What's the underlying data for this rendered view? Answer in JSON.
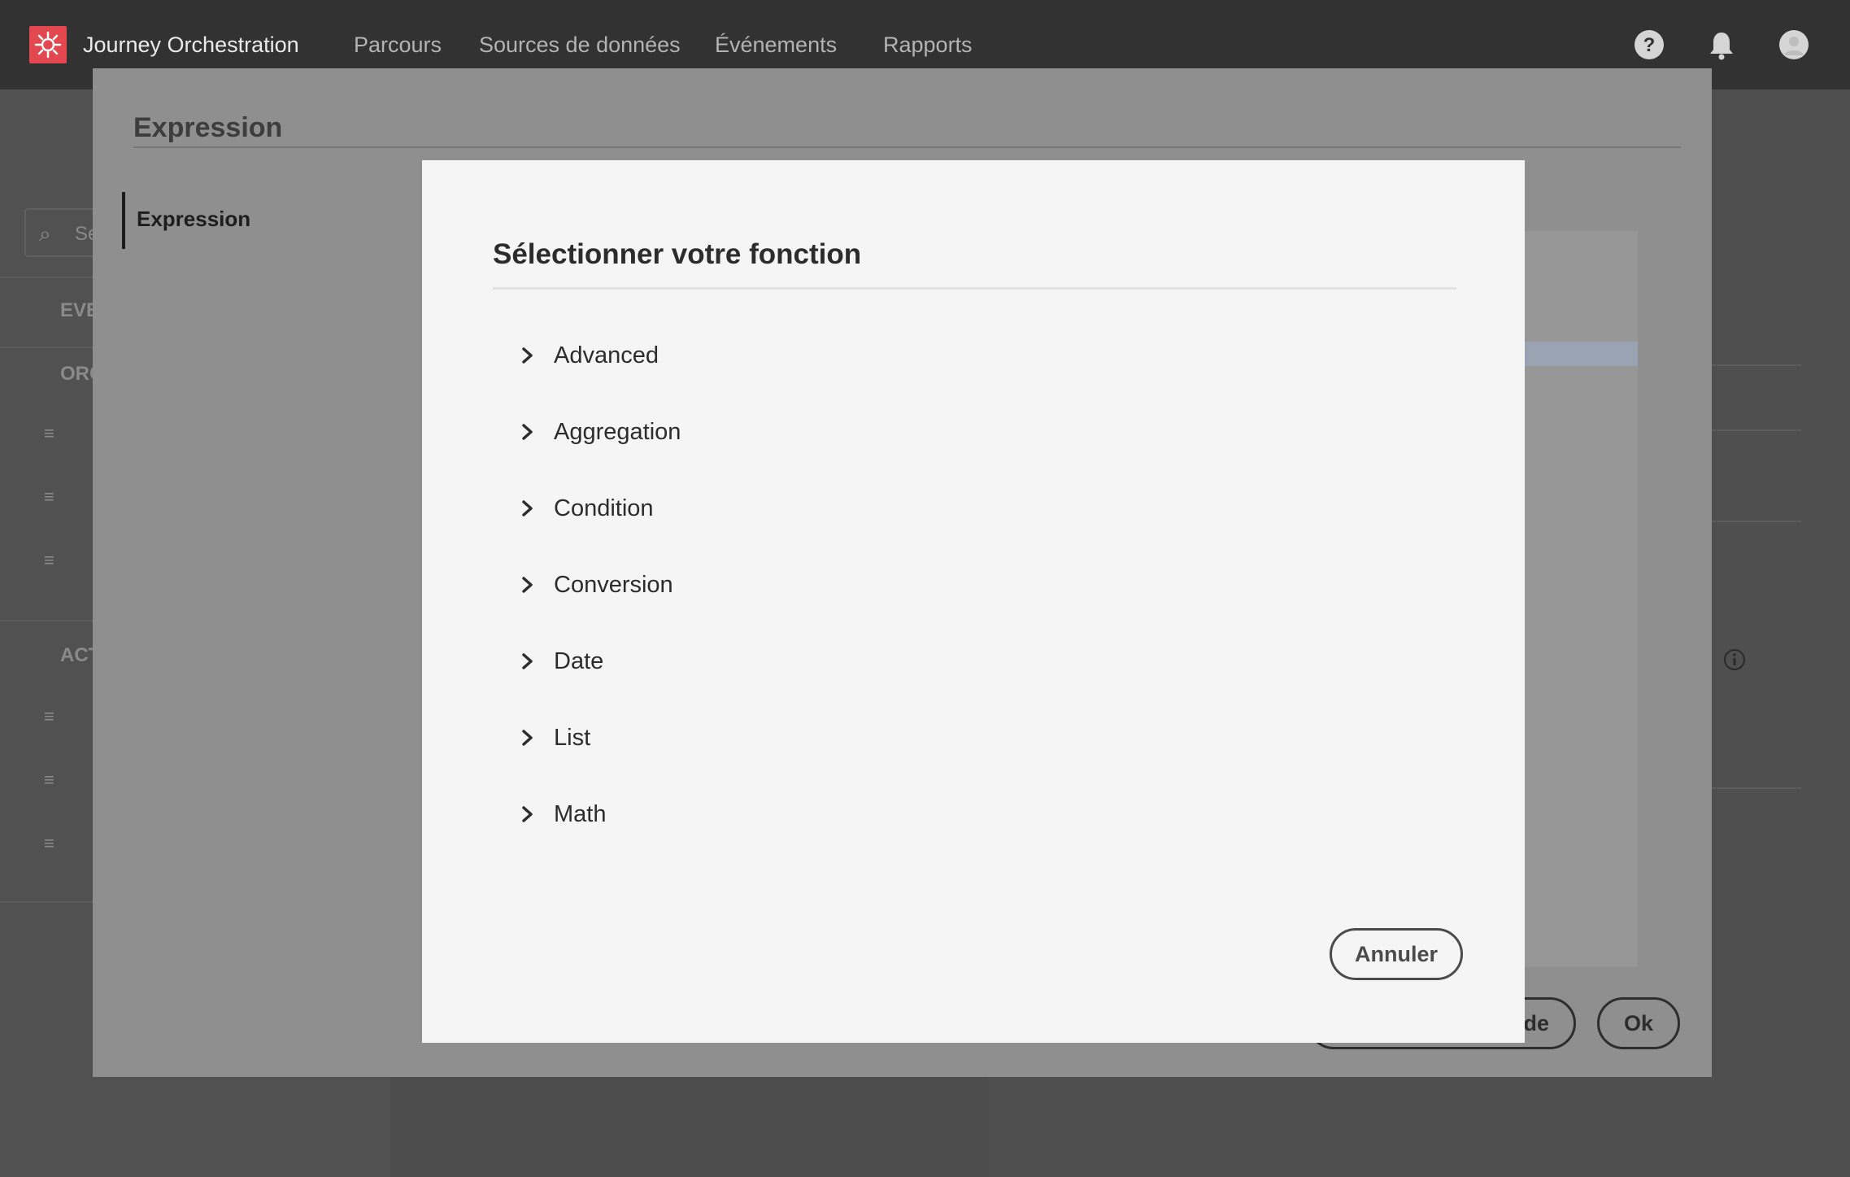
{
  "app": {
    "title": "Journey Orchestration",
    "nav": [
      "Parcours",
      "Sources de données",
      "Événements",
      "Rapports"
    ],
    "icons": [
      "help-icon",
      "bell-icon",
      "avatar-icon"
    ],
    "brand_color": "#e34850"
  },
  "background": {
    "search_placeholder_partial": "Se",
    "sections": [
      "EVE",
      "ORC",
      "ACT"
    ]
  },
  "expression_dialog": {
    "title": "Expression",
    "sidebar_item": "Expression",
    "buttons": {
      "partial": "de",
      "ok": "Ok"
    }
  },
  "function_picker": {
    "title": "Sélectionner votre fonction",
    "categories": [
      "Advanced",
      "Aggregation",
      "Condition",
      "Conversion",
      "Date",
      "List",
      "Math"
    ],
    "cancel_label": "Annuler"
  }
}
